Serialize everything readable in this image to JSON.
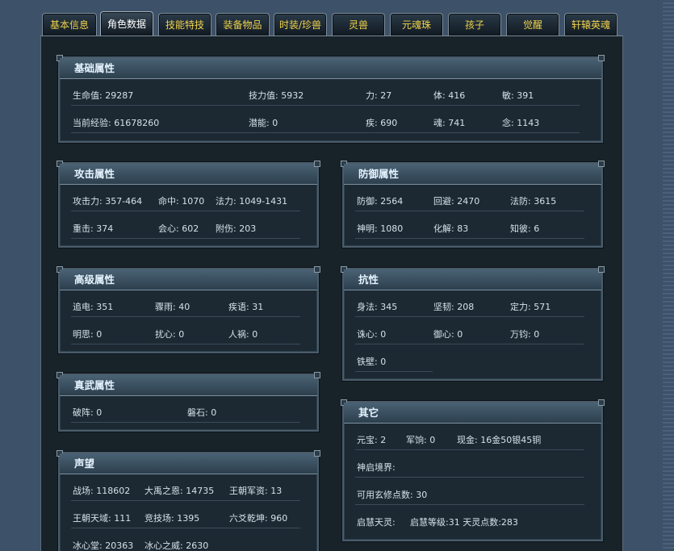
{
  "tabs": [
    {
      "label": "基本信息"
    },
    {
      "label": "角色数据"
    },
    {
      "label": "技能特技"
    },
    {
      "label": "装备物品"
    },
    {
      "label": "时装/珍兽"
    },
    {
      "label": "灵兽"
    },
    {
      "label": "元魂珠"
    },
    {
      "label": "孩子"
    },
    {
      "label": "觉醒"
    },
    {
      "label": "轩辕英魂"
    }
  ],
  "active_tab": "角色数据",
  "sections": {
    "basic": {
      "title": "基础属性",
      "rows": [
        [
          "生命值: 29287",
          "技力值: 5932",
          "力: 27",
          "体: 416",
          "敏: 391"
        ],
        [
          "当前经验: 61678260",
          "潜能: 0",
          "疾: 690",
          "魂: 741",
          "念: 1143"
        ]
      ]
    },
    "attack": {
      "title": "攻击属性",
      "rows": [
        [
          "攻击力: 357-464",
          "命中: 1070",
          "法力: 1049-1431"
        ],
        [
          "重击: 374",
          "会心: 602",
          "附伤: 203"
        ]
      ]
    },
    "defense": {
      "title": "防御属性",
      "rows": [
        [
          "防御: 2564",
          "回避: 2470",
          "法防: 3615"
        ],
        [
          "神明: 1080",
          "化解: 83",
          "知彼: 6"
        ]
      ]
    },
    "advanced": {
      "title": "高级属性",
      "rows": [
        [
          "追电: 351",
          "骤雨: 40",
          "疾语: 31"
        ],
        [
          "明思: 0",
          "扰心: 0",
          "人祸: 0"
        ]
      ]
    },
    "resist": {
      "title": "抗性",
      "rows": [
        [
          "身法: 345",
          "坚韧: 208",
          "定力: 571"
        ],
        [
          "诛心: 0",
          "御心: 0",
          "万钧: 0"
        ],
        [
          "铁壁: 0"
        ]
      ]
    },
    "zhenwu": {
      "title": "真武属性",
      "rows": [
        [
          "破阵: 0",
          "磐石: 0"
        ]
      ]
    },
    "other": {
      "title": "其它",
      "rows": [
        [
          "元宝: 2",
          "军饷: 0",
          "现金: 16金50银45铜"
        ],
        [
          "神启境界:"
        ],
        [
          "可用玄修点数: 30"
        ],
        [
          "启慧天灵:",
          "启慧等级:31 天灵点数:283"
        ]
      ]
    },
    "fame": {
      "title": "声望",
      "rows": [
        [
          "战场: 118602",
          "大禹之恩: 14735",
          "王朝军资: 13"
        ],
        [
          "王朝天域: 111",
          "竞技场: 1395",
          "六爻乾坤: 960"
        ],
        [
          "冰心堂: 20363",
          "冰心之威: 2630"
        ]
      ]
    }
  }
}
